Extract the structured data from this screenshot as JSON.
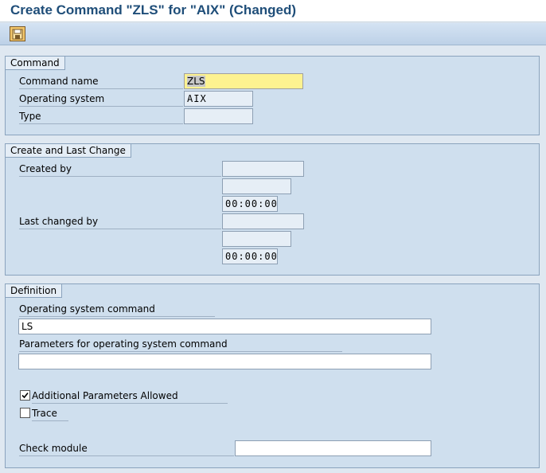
{
  "title": "Create Command \"ZLS\" for \"AIX\" (Changed)",
  "toolbar": {
    "save_icon": "save-icon"
  },
  "command_group": {
    "label": "Command",
    "command_name_label": "Command name",
    "command_name_value": "ZLS",
    "os_label": "Operating system",
    "os_value": "AIX",
    "type_label": "Type",
    "type_value": ""
  },
  "change_group": {
    "label": "Create and Last Change",
    "created_by_label": "Created by",
    "created_by_value": "",
    "created_date_value": "",
    "created_time_value": "00:00:00",
    "last_changed_label": "Last changed by",
    "last_changed_value": "",
    "changed_date_value": "",
    "changed_time_value": "00:00:00"
  },
  "definition_group": {
    "label": "Definition",
    "os_command_label": "Operating system command",
    "os_command_value": "LS",
    "params_label": "Parameters for operating system command",
    "params_value": "",
    "additional_params_label": "Additional Parameters Allowed",
    "additional_params_checked": true,
    "trace_label": "Trace",
    "trace_checked": false,
    "check_module_label": "Check module",
    "check_module_value": ""
  },
  "colors": {
    "title": "#1f4e79",
    "focus_field": "#fdf290",
    "group_bg": "#cfdfee"
  }
}
